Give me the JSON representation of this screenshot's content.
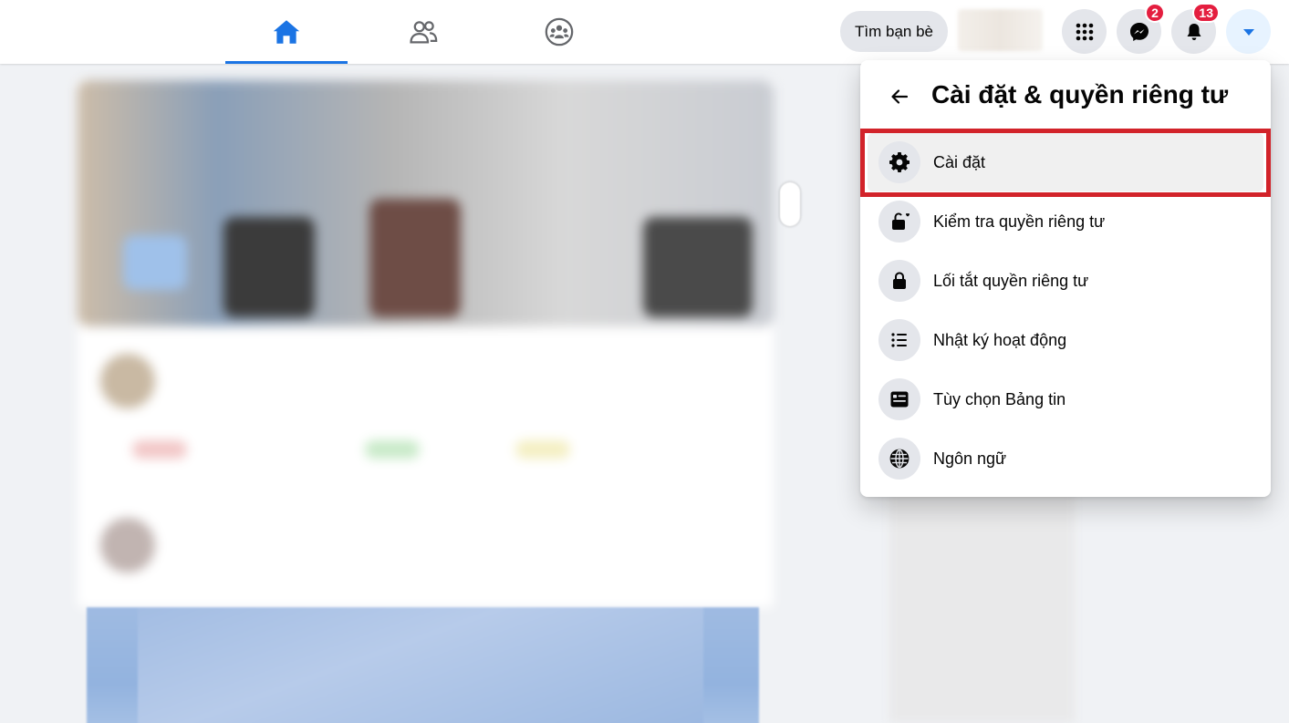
{
  "topbar": {
    "find_friends_label": "Tìm bạn bè",
    "messenger_badge": "2",
    "notifications_badge": "13",
    "accent_color": "#1b74e4",
    "badge_color": "#e41e3f"
  },
  "menu": {
    "title": "Cài đặt & quyền riêng tư",
    "items": [
      {
        "label": "Cài đặt",
        "icon": "gear-icon",
        "highlighted": true
      },
      {
        "label": "Kiểm tra quyền riêng tư",
        "icon": "lock-heart-icon"
      },
      {
        "label": "Lối tắt quyền riêng tư",
        "icon": "lock-icon"
      },
      {
        "label": "Nhật ký hoạt động",
        "icon": "list-icon"
      },
      {
        "label": "Tùy chọn Bảng tin",
        "icon": "news-feed-icon"
      },
      {
        "label": "Ngôn ngữ",
        "icon": "globe-icon"
      }
    ],
    "highlight_color": "#d2232a"
  }
}
